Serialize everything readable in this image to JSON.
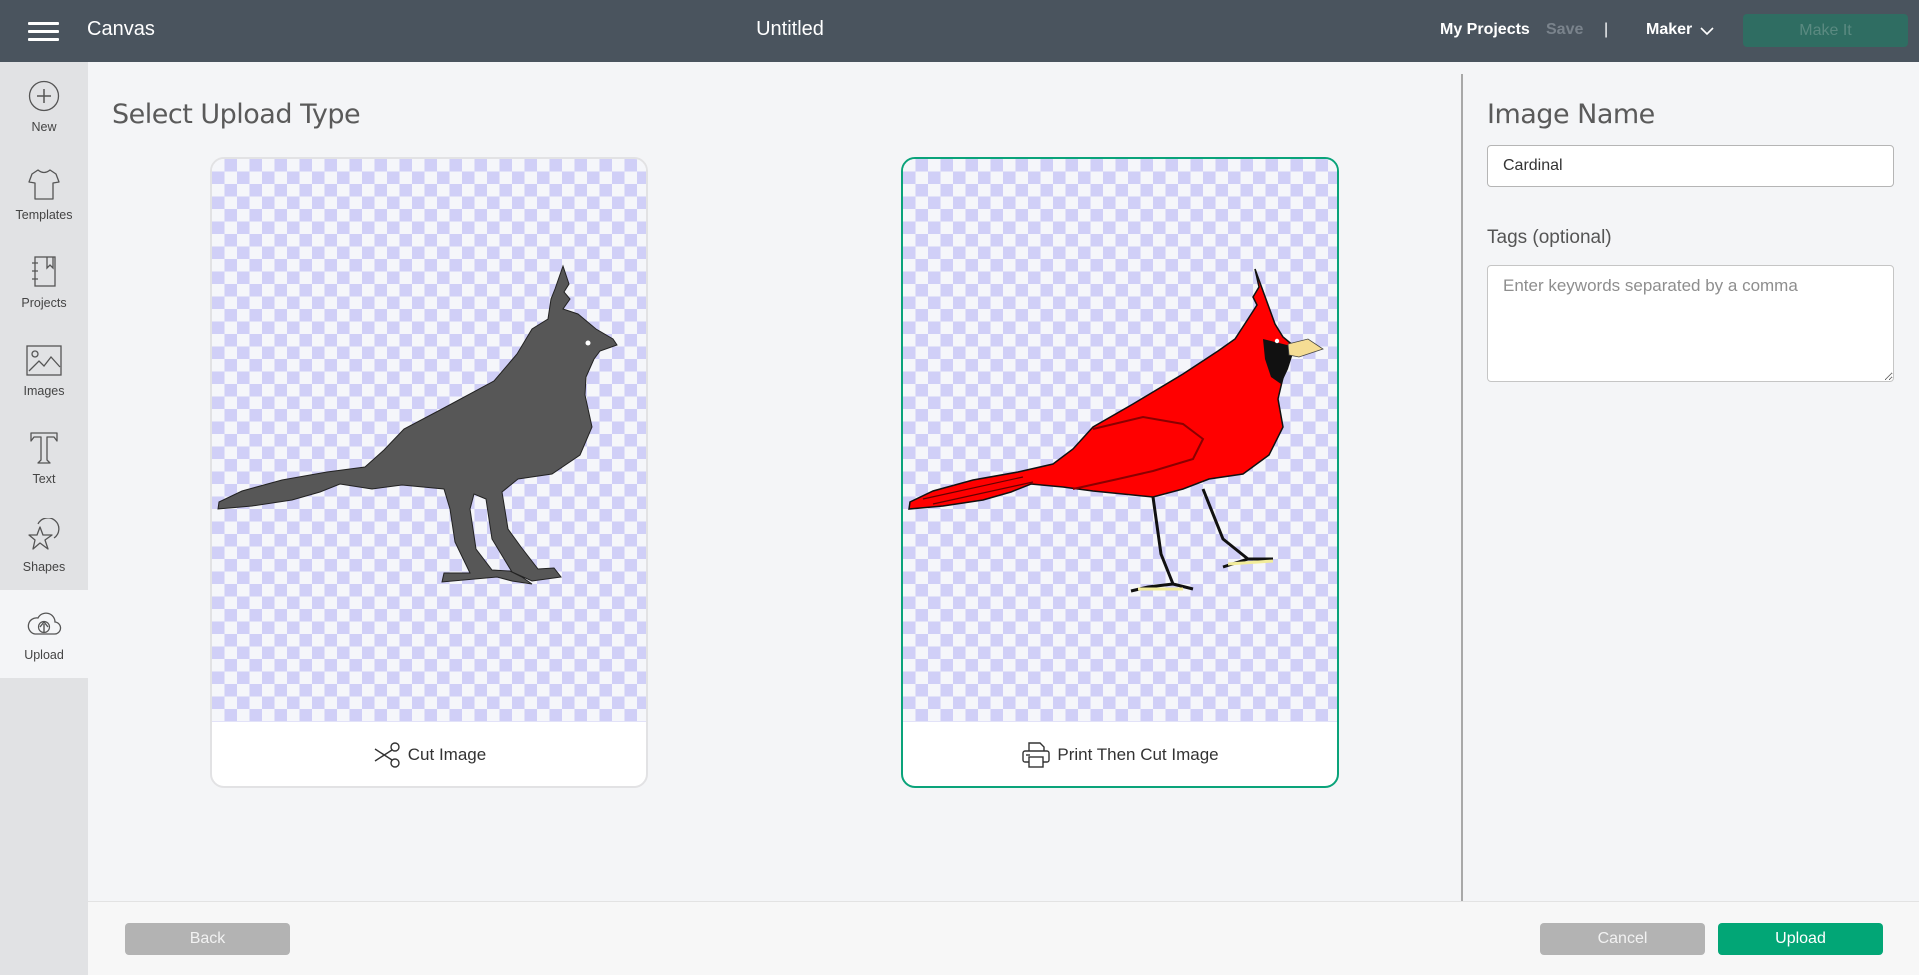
{
  "header": {
    "app_title": "Canvas",
    "doc_title": "Untitled",
    "my_projects": "My Projects",
    "save": "Save",
    "separator": "|",
    "machine": "Maker",
    "make_it": "Make It"
  },
  "sidebar": {
    "items": [
      {
        "label": "New",
        "icon": "plus-circle-icon"
      },
      {
        "label": "Templates",
        "icon": "tshirt-icon"
      },
      {
        "label": "Projects",
        "icon": "notebook-icon"
      },
      {
        "label": "Images",
        "icon": "image-icon"
      },
      {
        "label": "Text",
        "icon": "text-t-icon"
      },
      {
        "label": "Shapes",
        "icon": "shapes-icon"
      },
      {
        "label": "Upload",
        "icon": "cloud-upload-icon",
        "active": true
      }
    ]
  },
  "main": {
    "title": "Select Upload Type",
    "options": [
      {
        "label": "Cut Image",
        "icon": "scissors-icon",
        "selected": false
      },
      {
        "label": "Print Then Cut Image",
        "icon": "printer-icon",
        "selected": true
      }
    ]
  },
  "panel": {
    "image_name_label": "Image Name",
    "image_name_value": "Cardinal",
    "tags_label": "Tags (optional)",
    "tags_placeholder": "Enter keywords separated by a comma"
  },
  "footer": {
    "back": "Back",
    "cancel": "Cancel",
    "upload": "Upload"
  },
  "colors": {
    "header_bg": "#4a545e",
    "accent": "#02a676",
    "make_it_disabled": "#2f6d62",
    "checker": "#d0cff7"
  }
}
